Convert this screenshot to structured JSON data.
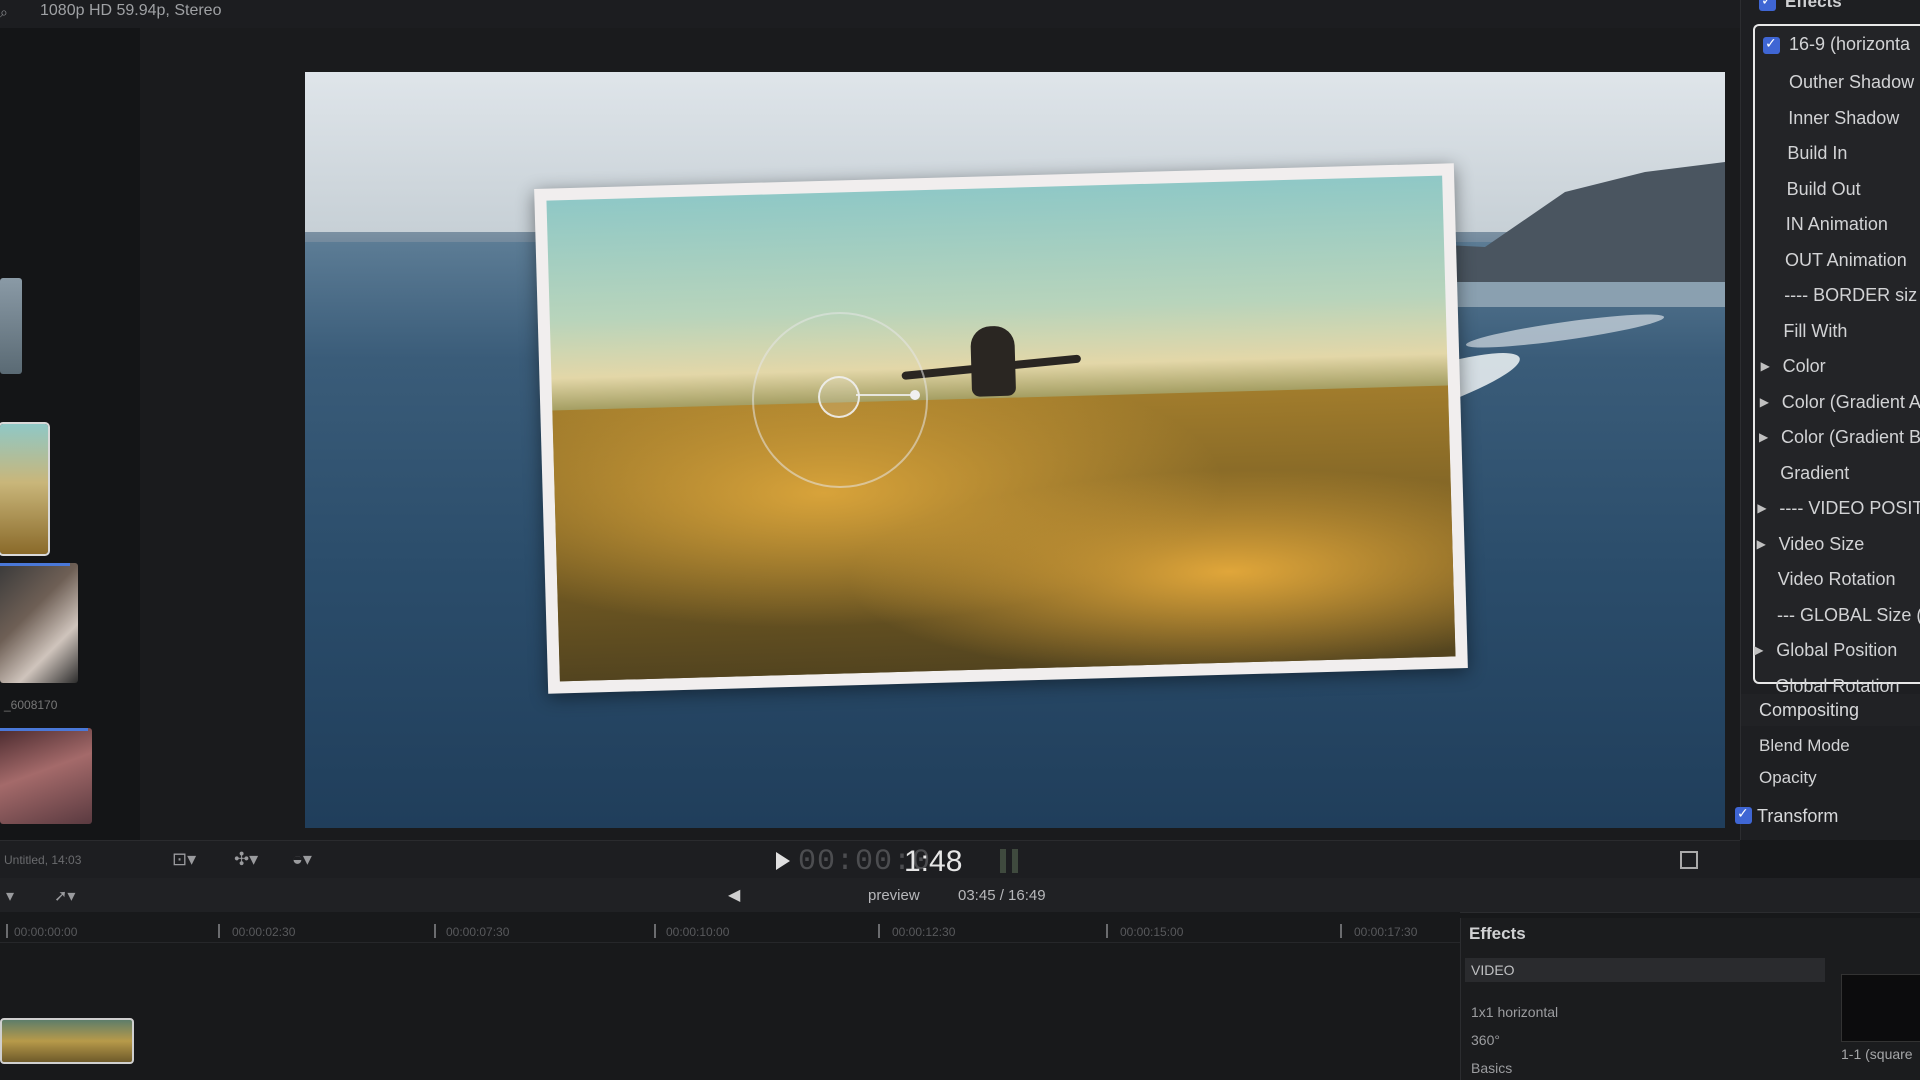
{
  "topbar": {
    "format": "1080p HD 59.94p, Stereo"
  },
  "browser": {
    "clip_label": "_6008170"
  },
  "transport": {
    "recent": "Untitled, 14:03",
    "timecode_dim": "00:00:0",
    "timecode": "1:48"
  },
  "timeline_header": {
    "project_name": "preview",
    "duration": "03:45 / 16:49"
  },
  "ruler": [
    "00:00:00:00",
    "00:00:02:30",
    "00:00:07:30",
    "00:00:10:00",
    "00:00:12:30",
    "00:00:15:00",
    "00:00:17:30"
  ],
  "effects_browser": {
    "title": "Effects",
    "category": "VIDEO",
    "items": [
      "1x1 horizontal",
      "360°",
      "Basics"
    ],
    "thumb_label": "1-1 (square"
  },
  "inspector": {
    "effects_head": "Effects",
    "effect_name": "16-9 (horizonta",
    "params": [
      {
        "label": "Outher Shadow",
        "tri": false
      },
      {
        "label": "Inner Shadow",
        "tri": false
      },
      {
        "label": "Build In",
        "tri": false
      },
      {
        "label": "Build Out",
        "tri": false
      },
      {
        "label": "IN Animation",
        "tri": false
      },
      {
        "label": "OUT Animation",
        "tri": false
      },
      {
        "label": "---- BORDER siz",
        "tri": false
      },
      {
        "label": "Fill With",
        "tri": false
      },
      {
        "label": "Color",
        "tri": true
      },
      {
        "label": "Color (Gradient A",
        "tri": true
      },
      {
        "label": "Color (Gradient B",
        "tri": true
      },
      {
        "label": "Gradient",
        "tri": false
      },
      {
        "label": "---- VIDEO POSIT",
        "tri": true
      },
      {
        "label": "Video Size",
        "tri": true
      },
      {
        "label": "Video Rotation",
        "tri": false
      },
      {
        "label": "--- GLOBAL Size (",
        "tri": false
      },
      {
        "label": "Global Position",
        "tri": true
      },
      {
        "label": "Global Rotation",
        "tri": false
      }
    ],
    "compositing": "Compositing",
    "blend_mode": "Blend Mode",
    "opacity": "Opacity",
    "transform": "Transform"
  },
  "colors": {
    "checkbox": "#3f66d4",
    "selection_border": "#e8e8e8"
  }
}
